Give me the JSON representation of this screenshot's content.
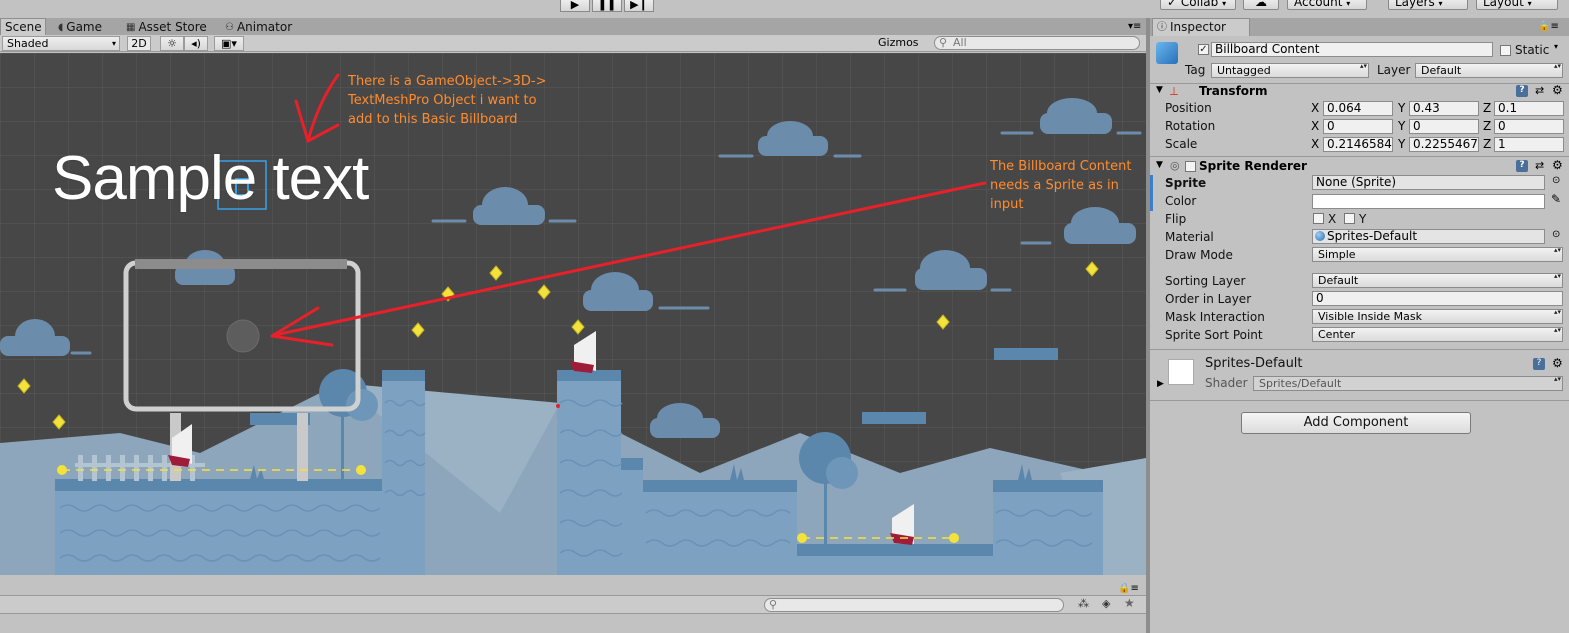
{
  "toolbar": {
    "play_icon": "play-icon",
    "pause_icon": "pause-icon",
    "step_icon": "step-icon",
    "collab": "Collab",
    "account": "Account",
    "layers": "Layers",
    "layout": "Layout"
  },
  "scene_tabs": {
    "scene": "Scene",
    "game": "Game",
    "asset_store": "Asset Store",
    "animator": "Animator"
  },
  "scene_toolbar": {
    "shading": "Shaded",
    "mode_2d": "2D",
    "gizmos": "Gizmos",
    "search_placeholder": "All"
  },
  "viewport": {
    "sample_text": "Sample text",
    "annotation_1": [
      "There is a GameObject->3D->",
      "TextMeshPro Object i want to",
      "add to this Basic Billboard"
    ],
    "annotation_2": [
      "The Billboard Content",
      "needs a Sprite as in",
      "input"
    ],
    "annotation_color": "#ff8c2e",
    "arrow_color": "#e8202a"
  },
  "inspector": {
    "tab": "Inspector",
    "object_name": "Billboard Content",
    "static_label": "Static",
    "tag_label": "Tag",
    "tag_value": "Untagged",
    "layer_label": "Layer",
    "layer_value": "Default",
    "transform": {
      "title": "Transform",
      "rows": [
        {
          "label": "Position",
          "x": "0.064",
          "y": "0.43",
          "z": "0.1"
        },
        {
          "label": "Rotation",
          "x": "0",
          "y": "0",
          "z": "0"
        },
        {
          "label": "Scale",
          "x": "0.2146584",
          "y": "0.2255467",
          "z": "1"
        }
      ],
      "axis_x": "X",
      "axis_y": "Y",
      "axis_z": "Z"
    },
    "sprite_renderer": {
      "title": "Sprite Renderer",
      "sprite_label": "Sprite",
      "sprite_value": "None (Sprite)",
      "color_label": "Color",
      "flip_label": "Flip",
      "flip_x": "X",
      "flip_y": "Y",
      "material_label": "Material",
      "material_value": "Sprites-Default",
      "draw_mode_label": "Draw Mode",
      "draw_mode_value": "Simple",
      "sorting_layer_label": "Sorting Layer",
      "sorting_layer_value": "Default",
      "order_label": "Order in Layer",
      "order_value": "0",
      "mask_label": "Mask Interaction",
      "mask_value": "Visible Inside Mask",
      "sort_point_label": "Sprite Sort Point",
      "sort_point_value": "Center"
    },
    "material": {
      "name": "Sprites-Default",
      "shader_label": "Shader",
      "shader_value": "Sprites/Default"
    },
    "add_component": "Add Component"
  }
}
